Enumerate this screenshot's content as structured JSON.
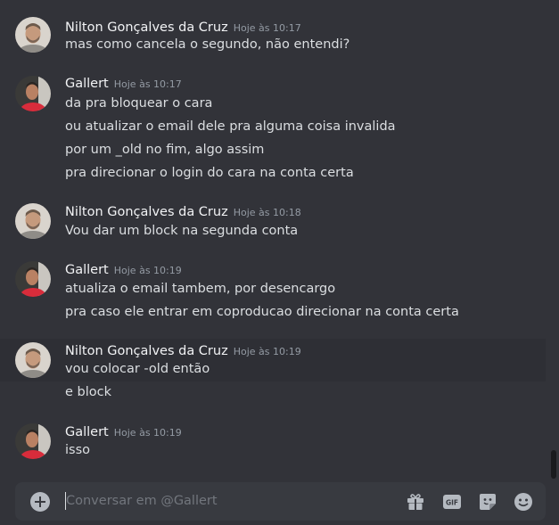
{
  "messages": {
    "groups": [
      {
        "author": "Nilton Gonçalves da Cruz",
        "time": "Hoje às 10:17",
        "lines": [
          "mas como cancela o segundo, não entendi?"
        ]
      },
      {
        "author": "Gallert",
        "time": "Hoje às 10:17",
        "lines": [
          "da pra bloquear o cara",
          "ou atualizar o email dele pra alguma coisa invalida",
          "por um _old no fim, algo assim",
          "pra direcionar o login do cara na conta certa"
        ]
      },
      {
        "author": "Nilton Gonçalves da Cruz",
        "time": "Hoje às 10:18",
        "lines": [
          "Vou dar um block na segunda conta"
        ]
      },
      {
        "author": "Gallert",
        "time": "Hoje às 10:19",
        "lines": [
          "atualiza o email tambem, por desencargo",
          "pra caso ele entrar em coproducao direcionar na conta certa"
        ]
      },
      {
        "author": "Nilton Gonçalves da Cruz",
        "time": "Hoje às 10:19",
        "lines": [
          "vou colocar -old então",
          "e block"
        ]
      },
      {
        "author": "Gallert",
        "time": "Hoje às 10:19",
        "lines": [
          "isso"
        ]
      }
    ]
  },
  "composer": {
    "placeholder": "Conversar em @Gallert",
    "value": ""
  },
  "icons": {
    "attach": "plus-circle-icon",
    "gift": "gift-icon",
    "gif": "gif-icon",
    "sticker": "sticker-icon",
    "emoji": "emoji-icon"
  },
  "icon_labels": {
    "gif": "GIF"
  },
  "colors": {
    "background": "#323339",
    "composer": "#383a40",
    "author": "#f2f3f5",
    "timestamp": "#949ba4",
    "text": "#dbdee1",
    "icon": "#b5bac1"
  }
}
